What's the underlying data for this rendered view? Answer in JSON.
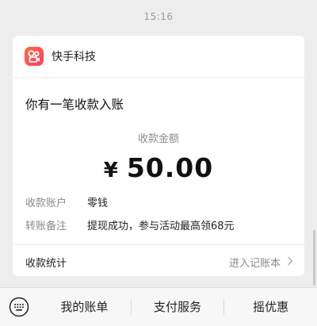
{
  "chat": {
    "timestamp": "15:16"
  },
  "card": {
    "merchant": "快手科技",
    "title": "你有一笔收款入账",
    "amount_label": "收款金额",
    "currency_symbol": "¥",
    "amount": "50.00",
    "details": [
      {
        "label": "收款账户",
        "value": "零钱"
      },
      {
        "label": "转账备注",
        "value": "提现成功，参与活动最高领68元"
      }
    ],
    "stats_label": "收款统计",
    "stats_link": "进入记账本"
  },
  "bottom_menu": {
    "items": [
      {
        "label": "我的账单"
      },
      {
        "label": "支付服务"
      },
      {
        "label": "摇优惠"
      }
    ]
  },
  "colors": {
    "background": "#ededed",
    "card": "#ffffff",
    "app_icon_gradient_start": "#ff6a3d",
    "app_icon_gradient_end": "#ff3d6b"
  },
  "icons": {
    "merchant_icon": "camera-film-icon",
    "keyboard": "keyboard-icon",
    "chevron": "chevron-right-icon"
  }
}
